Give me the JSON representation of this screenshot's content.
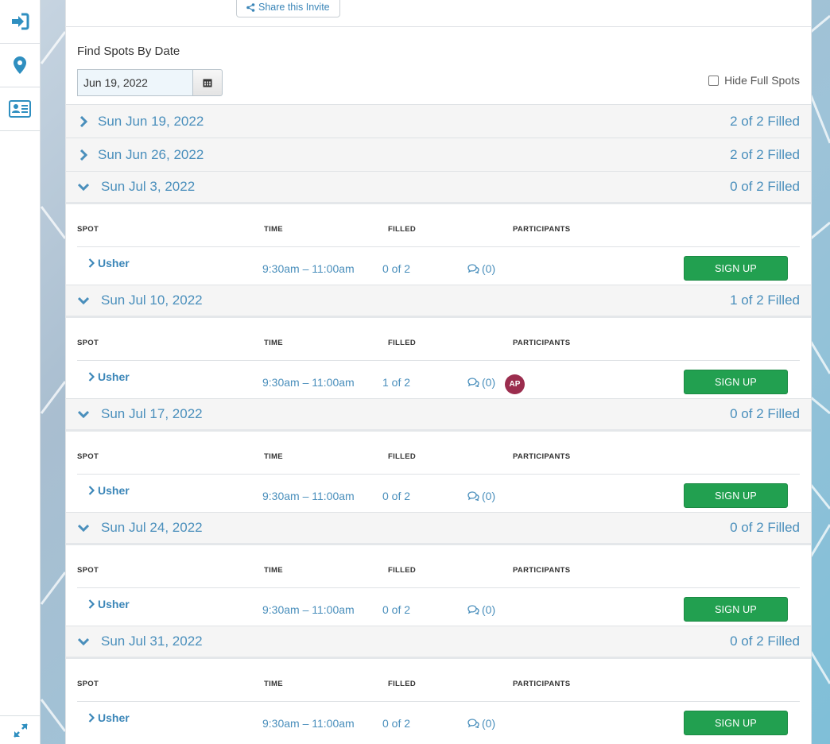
{
  "header": {
    "share_label": "Share this Invite"
  },
  "search": {
    "label": "Find Spots By Date",
    "date_value": "Jun 19, 2022",
    "hide_full_label": "Hide Full Spots"
  },
  "table_headers": {
    "spot": "SPOT",
    "time": "TIME",
    "filled": "FILLED",
    "participants": "PARTICIPANTS"
  },
  "signup_label": "SIGN UP",
  "dates": [
    {
      "label": "Sun Jun 19, 2022",
      "status": "2 of 2 Filled",
      "expanded": false
    },
    {
      "label": "Sun Jun 26, 2022",
      "status": "2 of 2 Filled",
      "expanded": false
    },
    {
      "label": "Sun Jul 3, 2022",
      "status": "0 of 2 Filled",
      "expanded": true,
      "spot": {
        "name": "Usher",
        "time": "9:30am – 11:00am",
        "filled": "0 of 2",
        "comments": "(0)",
        "participant": ""
      }
    },
    {
      "label": "Sun Jul 10, 2022",
      "status": "1 of 2 Filled",
      "expanded": true,
      "spot": {
        "name": "Usher",
        "time": "9:30am – 11:00am",
        "filled": "1 of 2",
        "comments": "(0)",
        "participant": "AP"
      }
    },
    {
      "label": "Sun Jul 17, 2022",
      "status": "0 of 2 Filled",
      "expanded": true,
      "spot": {
        "name": "Usher",
        "time": "9:30am – 11:00am",
        "filled": "0 of 2",
        "comments": "(0)",
        "participant": ""
      }
    },
    {
      "label": "Sun Jul 24, 2022",
      "status": "0 of 2 Filled",
      "expanded": true,
      "spot": {
        "name": "Usher",
        "time": "9:30am – 11:00am",
        "filled": "0 of 2",
        "comments": "(0)",
        "participant": ""
      }
    },
    {
      "label": "Sun Jul 31, 2022",
      "status": "0 of 2 Filled",
      "expanded": true,
      "spot": {
        "name": "Usher",
        "time": "9:30am – 11:00am",
        "filled": "0 of 2",
        "comments": "(0)",
        "participant": ""
      }
    }
  ],
  "sidebar": {
    "icons": [
      "sign-in-icon",
      "map-marker-icon",
      "id-card-icon"
    ],
    "bottom_icon": "expand-icon"
  },
  "colors": {
    "link": "#4a8fbc",
    "signup_green": "#22a050",
    "avatar": "#9b2d4e",
    "sidebar_icon": "#2f8fc0"
  }
}
